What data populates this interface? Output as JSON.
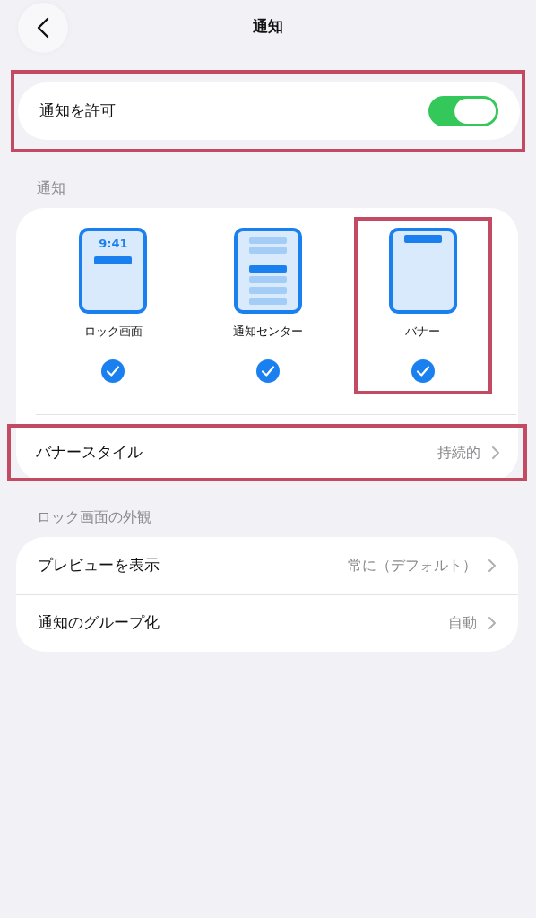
{
  "header": {
    "title": "通知"
  },
  "allow": {
    "label": "通知を許可",
    "on": true,
    "highlighted": true
  },
  "sections": [
    {
      "header": "通知",
      "styles": [
        {
          "kind": "lock",
          "time": "9:41",
          "label": "ロック画面",
          "checked": true,
          "highlighted": false
        },
        {
          "kind": "center",
          "label": "通知センター",
          "checked": true,
          "highlighted": false
        },
        {
          "kind": "banner",
          "label": "バナー",
          "checked": true,
          "highlighted": true
        }
      ],
      "rows": [
        {
          "label": "バナースタイル",
          "value": "持続的",
          "highlighted": true
        }
      ]
    },
    {
      "header": "ロック画面の外観",
      "rows": [
        {
          "label": "プレビューを表示",
          "value": "常に（デフォルト）",
          "highlighted": false
        },
        {
          "label": "通知のグループ化",
          "value": "自動",
          "highlighted": false
        }
      ]
    }
  ]
}
